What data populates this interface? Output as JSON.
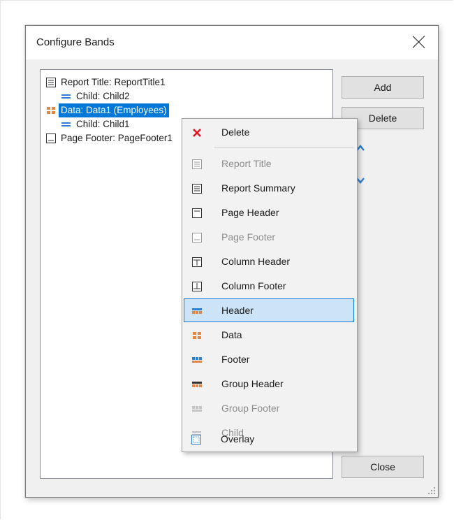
{
  "dialog": {
    "title": "Configure Bands"
  },
  "tree": {
    "items": [
      {
        "label": "Report Title: ReportTitle1",
        "icon": "report-title-icon"
      },
      {
        "label": "Child: Child2",
        "icon": "child-band-icon"
      },
      {
        "label": "Data: Data1 (Employees)",
        "icon": "data-band-icon",
        "selected": true
      },
      {
        "label": "Child: Child1",
        "icon": "child-band-icon"
      },
      {
        "label": "Page Footer: PageFooter1",
        "icon": "page-footer-icon"
      }
    ]
  },
  "buttons": {
    "add": "Add",
    "delete": "Delete",
    "close": "Close"
  },
  "context_menu": {
    "items": [
      {
        "label": "Delete",
        "icon": "delete-x-icon",
        "enabled": true
      },
      {
        "label": "Report Title",
        "icon": "report-title-icon",
        "enabled": false
      },
      {
        "label": "Report Summary",
        "icon": "report-summary-icon",
        "enabled": true
      },
      {
        "label": "Page Header",
        "icon": "page-header-icon",
        "enabled": true
      },
      {
        "label": "Page Footer",
        "icon": "page-footer-icon",
        "enabled": false
      },
      {
        "label": "Column Header",
        "icon": "column-header-icon",
        "enabled": true
      },
      {
        "label": "Column Footer",
        "icon": "column-footer-icon",
        "enabled": true
      },
      {
        "label": "Header",
        "icon": "header-band-icon",
        "enabled": true,
        "highlighted": true
      },
      {
        "label": "Data",
        "icon": "data-band-icon",
        "enabled": true
      },
      {
        "label": "Footer",
        "icon": "footer-band-icon",
        "enabled": true
      },
      {
        "label": "Group Header",
        "icon": "group-header-icon",
        "enabled": true
      },
      {
        "label": "Group Footer",
        "icon": "group-footer-icon",
        "enabled": false
      },
      {
        "label": "Child",
        "icon": "child-band-icon",
        "enabled": false
      },
      {
        "label": "Overlay",
        "icon": "overlay-band-icon",
        "enabled": true
      }
    ]
  },
  "colors": {
    "selection": "#0078d7",
    "menu_highlight": "#cce4f7",
    "delete_red": "#e81123"
  }
}
